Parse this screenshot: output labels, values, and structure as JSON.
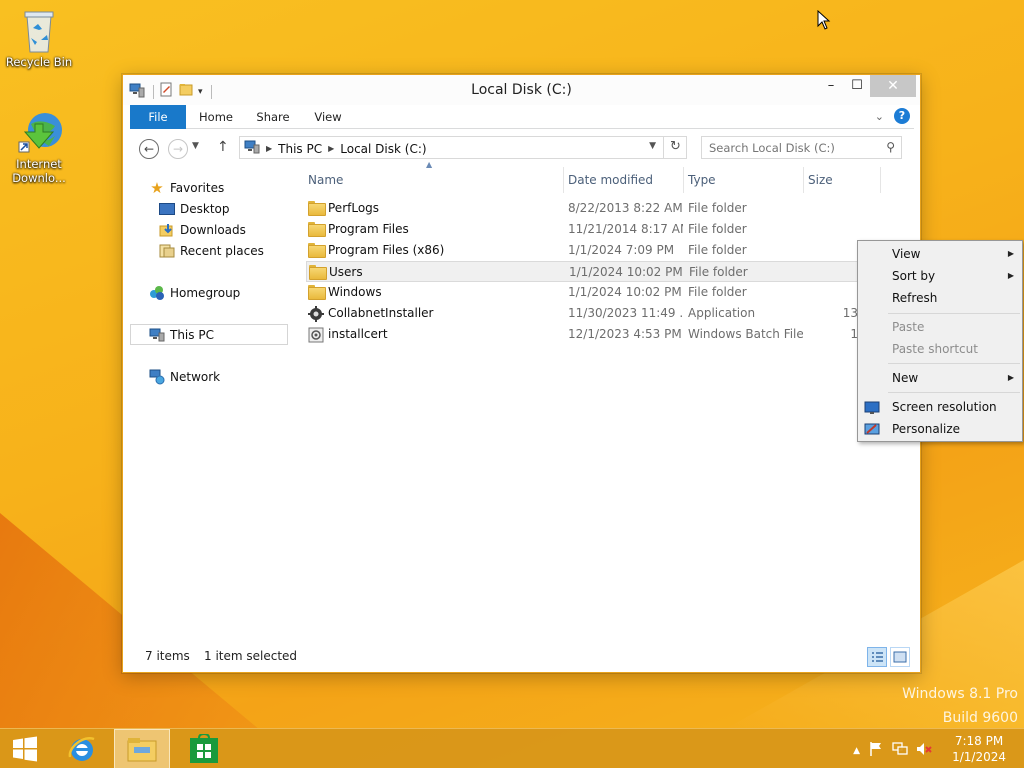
{
  "desktop": {
    "icons": [
      {
        "label": "Recycle Bin"
      },
      {
        "label": "Internet Downlo..."
      }
    ],
    "watermark": {
      "line1": "Windows 8.1 Pro",
      "line2": "Build 9600"
    }
  },
  "window": {
    "title": "Local Disk (C:)",
    "controls": {
      "minimize": "–",
      "maximize": "☐",
      "close": "✕"
    },
    "ribbon_tabs": [
      "File",
      "Home",
      "Share",
      "View"
    ],
    "address": {
      "crumbs": [
        "This PC",
        "Local Disk (C:)"
      ]
    },
    "search": {
      "placeholder": "Search Local Disk (C:)"
    },
    "nav": {
      "favorites": "Favorites",
      "desktop": "Desktop",
      "downloads": "Downloads",
      "recent": "Recent places",
      "homegroup": "Homegroup",
      "thispc": "This PC",
      "network": "Network"
    },
    "columns": {
      "name": "Name",
      "date": "Date modified",
      "type": "Type",
      "size": "Size"
    },
    "files": [
      {
        "name": "PerfLogs",
        "date": "8/22/2013 8:22 AM",
        "type": "File folder",
        "size": "",
        "icon": "folder-icon"
      },
      {
        "name": "Program Files",
        "date": "11/21/2014 8:17 AM",
        "type": "File folder",
        "size": "",
        "icon": "folder-icon"
      },
      {
        "name": "Program Files (x86)",
        "date": "1/1/2024 7:09 PM",
        "type": "File folder",
        "size": "",
        "icon": "folder-icon"
      },
      {
        "name": "Users",
        "date": "1/1/2024 10:02 PM",
        "type": "File folder",
        "size": "",
        "icon": "folder-icon"
      },
      {
        "name": "Windows",
        "date": "1/1/2024 10:02 PM",
        "type": "File folder",
        "size": "",
        "icon": "folder-icon"
      },
      {
        "name": "CollabnetInstaller",
        "date": "11/30/2023 11:49 ...",
        "type": "Application",
        "size": "13",
        "icon": "application-icon"
      },
      {
        "name": "installcert",
        "date": "12/1/2023 4:53 PM",
        "type": "Windows Batch File",
        "size": "1",
        "icon": "batch-file-icon"
      }
    ],
    "status": {
      "count": "7 items",
      "selected": "1 item selected"
    }
  },
  "context_menu": {
    "view": "View",
    "sort_by": "Sort by",
    "refresh": "Refresh",
    "paste": "Paste",
    "paste_shortcut": "Paste shortcut",
    "new": "New",
    "screen_resolution": "Screen resolution",
    "personalize": "Personalize"
  },
  "taskbar": {
    "time": "7:18 PM",
    "date": "1/1/2024"
  },
  "colors": {
    "accent": "#1979ca",
    "desktop": "#f7b11a"
  }
}
